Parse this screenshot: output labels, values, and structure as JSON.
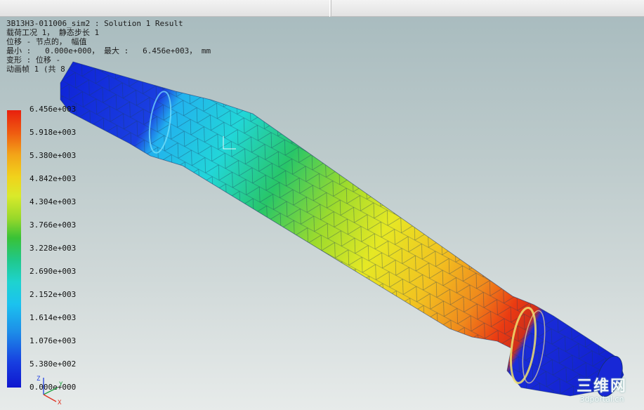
{
  "header": {
    "title": "3B13H3-011006_sim2 : Solution 1 Result",
    "load_case": "载荷工况 1， 静态步长 1",
    "result_type": "位移 - 节点的， 幅值",
    "min_max": "最小 :   0.000e+000， 最大 :   6.456e+003， mm",
    "deformation": "变形 : 位移 -",
    "animation": "动画帧 1 (共 8"
  },
  "legend": {
    "ticks": [
      "6.456e+003",
      "5.918e+003",
      "5.380e+003",
      "4.842e+003",
      "4.304e+003",
      "3.766e+003",
      "3.228e+003",
      "2.690e+003",
      "2.152e+003",
      "1.614e+003",
      "1.076e+003",
      "5.380e+002",
      "0.000e+000"
    ],
    "color_top": "#e8200e",
    "color_bottom": "#0f17cf"
  },
  "triad": {
    "x_label": "X",
    "y_label": "Y",
    "z_label": "Z",
    "x_color": "#e03020",
    "y_color": "#20a040",
    "z_color": "#2040e0"
  },
  "watermark": {
    "main": "三维网",
    "sub": "3dportal.cn"
  },
  "colors": {
    "background_top": "#a9bcbf",
    "background_bottom": "#e7ebea",
    "mesh_line": "#1b3b5a"
  }
}
